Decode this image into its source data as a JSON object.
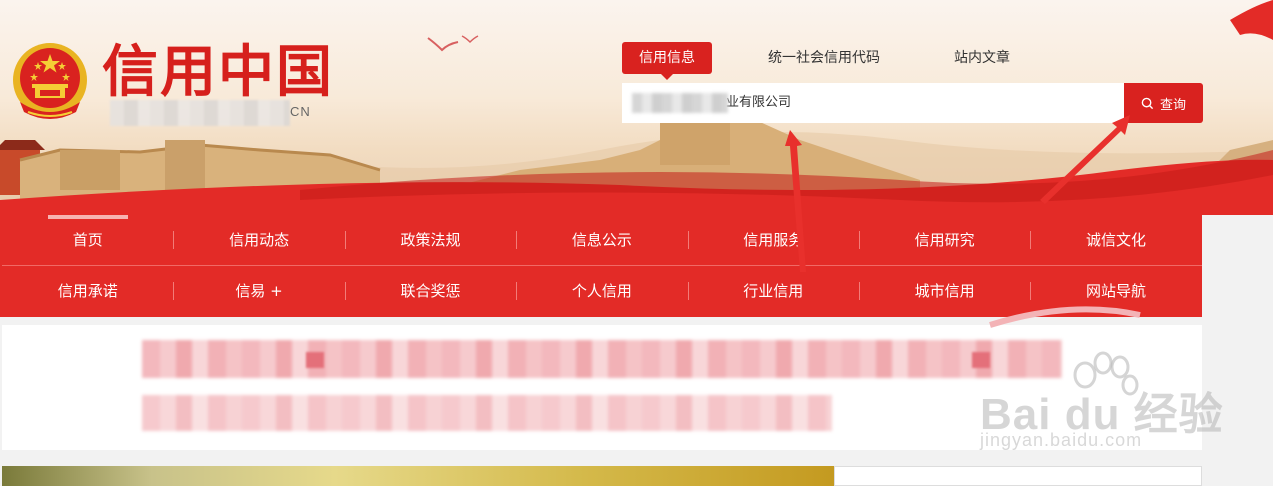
{
  "header": {
    "site_title": "信用中国",
    "site_url_suffix": "CN",
    "search_tabs": [
      {
        "label": "信用信息",
        "active": true
      },
      {
        "label": "统一社会信用代码",
        "active": false
      },
      {
        "label": "站内文章",
        "active": false
      }
    ],
    "search": {
      "value": "业有限公司",
      "button_label": "查询",
      "button_icon": "search-icon"
    }
  },
  "nav": {
    "row1": [
      {
        "label": "首页",
        "active": true
      },
      {
        "label": "信用动态"
      },
      {
        "label": "政策法规"
      },
      {
        "label": "信息公示"
      },
      {
        "label": "信用服务"
      },
      {
        "label": "信用研究"
      },
      {
        "label": "诚信文化"
      }
    ],
    "row2": [
      {
        "label": "信用承诺"
      },
      {
        "label": "信易 +"
      },
      {
        "label": "联合奖惩"
      },
      {
        "label": "个人信用"
      },
      {
        "label": "行业信用"
      },
      {
        "label": "城市信用"
      },
      {
        "label": "网站导航"
      }
    ]
  },
  "watermark": {
    "logo_text": "Bai du 经验",
    "url": "jingyan.baidu.com"
  },
  "colors": {
    "brand_red": "#d9221f",
    "nav_red": "#e32b27",
    "annotation_red": "#e8302c"
  }
}
